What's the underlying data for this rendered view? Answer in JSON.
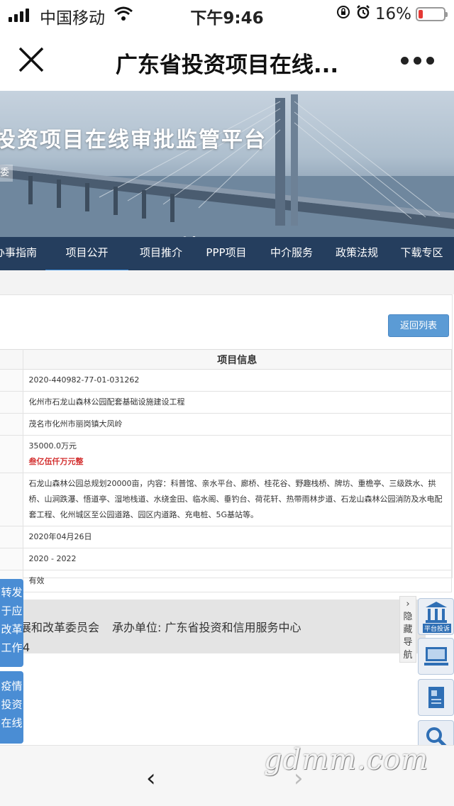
{
  "status_bar": {
    "carrier": "中国移动",
    "time": "下午9:46",
    "battery": "16%"
  },
  "navbar": {
    "title": "广东省投资项目在线..."
  },
  "banner": {
    "headline": "投资项目在线审批监管平台",
    "tag": "委"
  },
  "tabs": [
    {
      "label": "办事指南"
    },
    {
      "label": "项目公开"
    },
    {
      "label": "项目推介"
    },
    {
      "label": "PPP项目"
    },
    {
      "label": "中介服务"
    },
    {
      "label": "政策法规"
    },
    {
      "label": "下载专区"
    }
  ],
  "back_button": "返回列表",
  "table": {
    "header": "项目信息",
    "rows": {
      "code": "2020-440982-77-01-031262",
      "name": "化州市石龙山森林公园配套基础设施建设工程",
      "location": "茂名市化州市丽岗镇大凤岭",
      "amount": "35000.0万元",
      "amount_cn": "叁亿伍仟万元整",
      "scope": "石龙山森林公园总规划20000亩，内容：科普馆、亲水平台、廊桥、桂花谷、野趣栈桥、牌坊、重檐亭、三级跌水、拱桥、山涧跌瀑、悟道亭、湿地栈道、水绕金田、临水阁、垂钓台、荷花轩、热带雨林步道、石龙山森林公园消防及水电配套工程、化州城区至公园道路、园区内道路、充电桩、5G基站等。",
      "date": "2020年04月26日",
      "period": "2020 - 2022",
      "status": "有效"
    }
  },
  "footer": {
    "sponsor": "展和改革委员会",
    "organizer_label": "承办单位:",
    "organizer": "广东省投资和信用服务中心",
    "line2": "2号-4"
  },
  "side_buttons": {
    "forward": "转发于应改革工作",
    "epidemic": "疫情投资在线"
  },
  "hidden_nav": "隐藏导航",
  "right_icons": {
    "platform_label": "平台投诉"
  },
  "watermark": "gdmm.com"
}
